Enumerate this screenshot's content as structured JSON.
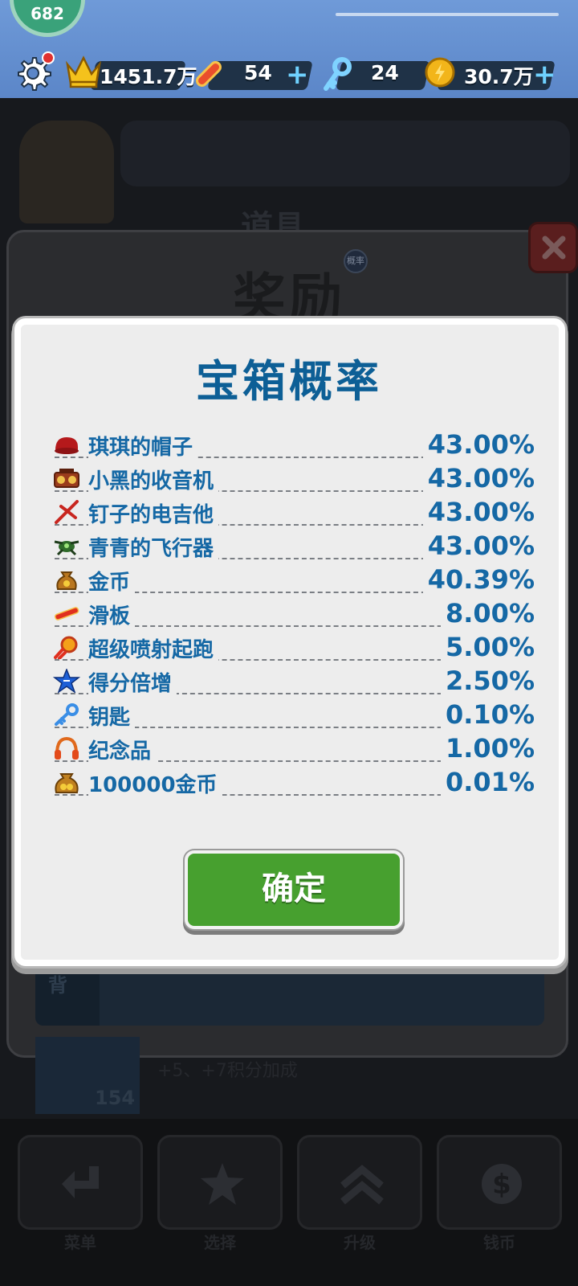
{
  "status_bar": {
    "avatar_text": "682",
    "crowns": "1451.7万",
    "boards": "54",
    "keys": "24",
    "coins": "30.7万"
  },
  "background": {
    "header_text": "道具",
    "panel_title": "奖励",
    "panel_badge": "概率",
    "strip_label": "背",
    "row_number": "154",
    "row_text": "+5、+7积分加成",
    "nav": [
      {
        "label": "菜单"
      },
      {
        "label": "选择"
      },
      {
        "label": "升级"
      },
      {
        "label": "钱币"
      }
    ]
  },
  "modal": {
    "title": "宝箱概率",
    "items": [
      {
        "icon": "hat-icon",
        "name": "琪琪的帽子",
        "pct": "43.00%"
      },
      {
        "icon": "radio-icon",
        "name": "小黑的收音机",
        "pct": "43.00%"
      },
      {
        "icon": "guitar-icon",
        "name": "钉子的电吉他",
        "pct": "43.00%"
      },
      {
        "icon": "drone-icon",
        "name": "青青的飞行器",
        "pct": "43.00%"
      },
      {
        "icon": "coin-bag-icon",
        "name": "金币",
        "pct": "40.39%"
      },
      {
        "icon": "skateboard-icon",
        "name": "滑板",
        "pct": "8.00%"
      },
      {
        "icon": "jetpack-icon",
        "name": "超级喷射起跑",
        "pct": "5.00%"
      },
      {
        "icon": "star-icon",
        "name": "得分倍增",
        "pct": "2.50%"
      },
      {
        "icon": "key-icon",
        "name": "钥匙",
        "pct": "0.10%"
      },
      {
        "icon": "headphones-icon",
        "name": "纪念品",
        "pct": "1.00%"
      },
      {
        "icon": "big-coin-bag-icon",
        "name": "100000金币",
        "pct": "0.01%"
      }
    ],
    "confirm_label": "确定"
  }
}
